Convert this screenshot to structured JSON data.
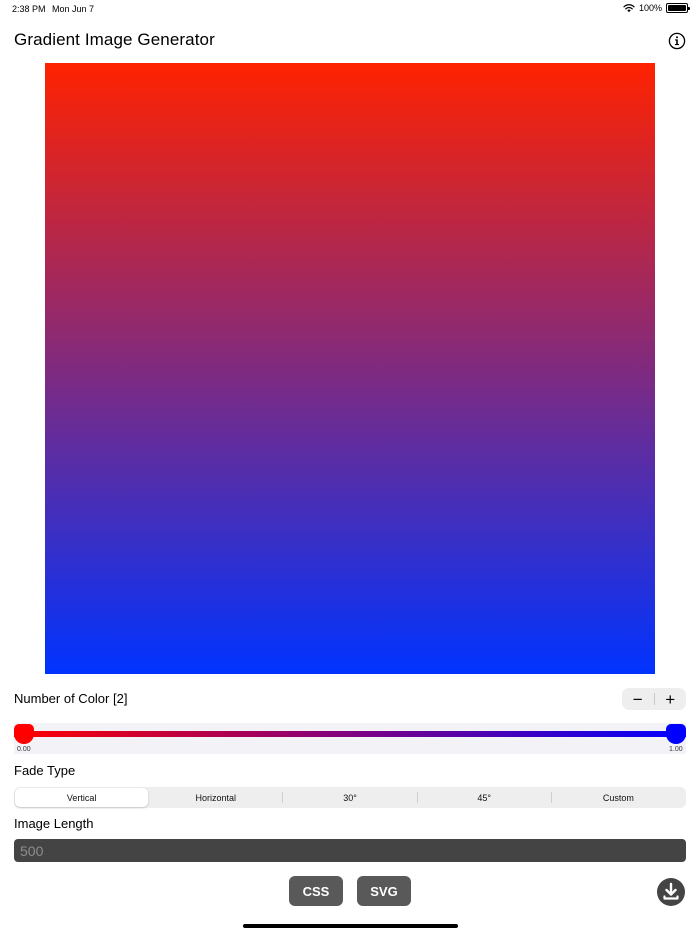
{
  "status": {
    "time": "2:38 PM",
    "date": "Mon Jun 7",
    "battery": "100%"
  },
  "app": {
    "title": "Gradient Image Generator"
  },
  "icons": {
    "info": "info-circle-icon",
    "download": "download-circle-icon",
    "wifi": "wifi-icon",
    "battery": "battery-icon"
  },
  "gradient": {
    "start_color": "#ff2200",
    "end_color": "#0033ff"
  },
  "number_of_color": {
    "label": "Number of Color [2]",
    "minus": "−",
    "plus": "+"
  },
  "color_stops": [
    {
      "position": "0.00",
      "color": "#ff0000"
    },
    {
      "position": "1.00",
      "color": "#0000ff"
    }
  ],
  "fade_type": {
    "label": "Fade Type",
    "options": [
      "Vertical",
      "Horizontal",
      "30°",
      "45°",
      "Custom"
    ],
    "selected": "Vertical"
  },
  "image_length": {
    "label": "Image Length",
    "placeholder": "500"
  },
  "export": {
    "css": "CSS",
    "svg": "SVG"
  }
}
